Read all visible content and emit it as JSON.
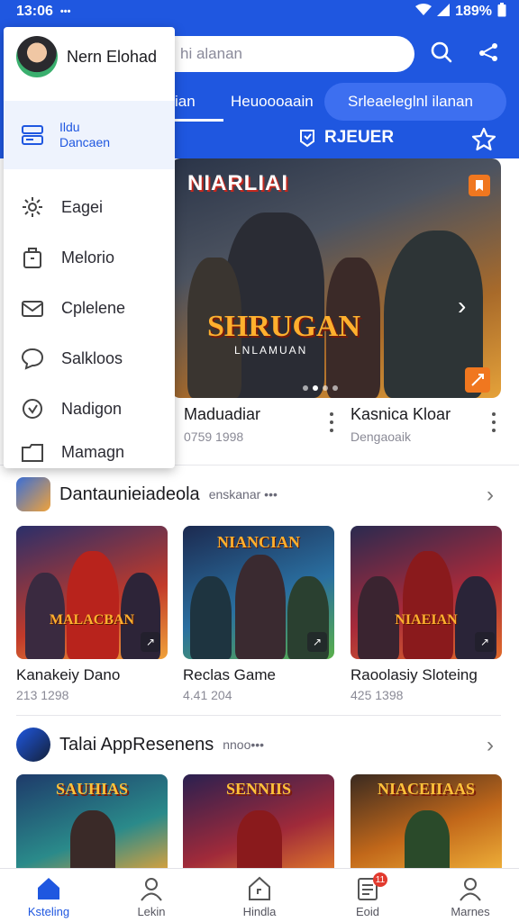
{
  "status_bar": {
    "time": "13:06",
    "dots": "•••",
    "battery": "189%"
  },
  "header": {
    "search_placeholder": "hi alanan",
    "tabs": [
      "ian",
      "Heuoooaain",
      "Srleaeleglnl ilanan"
    ],
    "reader_label": "RJEUER"
  },
  "hero": {
    "title": "NIARLIAI",
    "subtitle": "SHRUGAN",
    "subtitle_small": "LNLAMUAN",
    "next_glyph": "›"
  },
  "hero_cards": [
    {
      "title": "Maduadiar",
      "subtitle": "0759 1998"
    },
    {
      "title": "Kasnica Kloar",
      "subtitle": "Dengaoaik"
    }
  ],
  "section1": {
    "title": "Dantaunieiadeola",
    "meta": "enskanar •••",
    "tiles": [
      {
        "banner": "MALACBAN",
        "name": "Kanakeiy Dano",
        "sub": "213 1298"
      },
      {
        "banner": "NIANCIAN",
        "name": "Reclas Game",
        "sub": "4.41 204"
      },
      {
        "banner": "NIAEIAN",
        "name": "Raoolasiy Sloteing",
        "sub": "425 1398"
      }
    ]
  },
  "section2": {
    "title": "Talai AppResenens",
    "meta": "nnoo•••",
    "tiles": [
      {
        "banner": "SAUHIAS"
      },
      {
        "banner": "SENNIIS"
      },
      {
        "banner": "NIACEIIAAS"
      }
    ]
  },
  "drawer": {
    "profile_name": "Nern Elohad",
    "active_item": {
      "line1": "Ildu",
      "line2": "Dancaen"
    },
    "items": [
      "Eagei",
      "Melorio",
      "Cplelene",
      "Salkloos",
      "Nadigon",
      "Mamagn"
    ]
  },
  "bottom_nav": {
    "items": [
      "Ksteling",
      "Lekin",
      "Hindla",
      "Eoid",
      "Marnes"
    ],
    "badge": "11"
  },
  "colors": {
    "accent": "#1f57e0",
    "badge": "#e23a2e",
    "orange": "#f0771f"
  }
}
